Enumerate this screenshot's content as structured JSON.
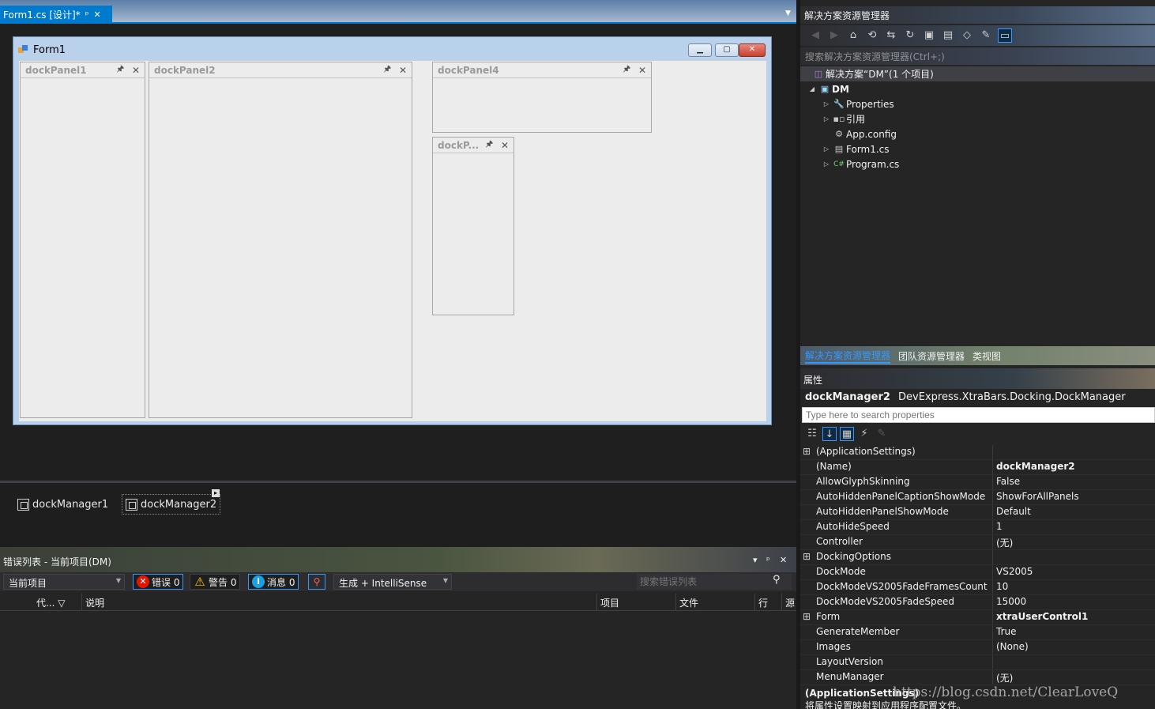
{
  "doc_tab": {
    "title": "Form1.cs [设计]*",
    "pin": "ᵖ",
    "close": "✕"
  },
  "form": {
    "title": "Form1",
    "panels": [
      {
        "caption": "dockPanel1"
      },
      {
        "caption": "dockPanel2"
      },
      {
        "caption": "dockPanel4"
      },
      {
        "caption": "dockP..."
      }
    ],
    "pin_glyph": "🖈",
    "close_glyph": "✕"
  },
  "tray": {
    "items": [
      "dockManager1",
      "dockManager2"
    ]
  },
  "error_list": {
    "title": "错误列表 - 当前项目(DM)",
    "scope": "当前项目",
    "errors_label": "错误 0",
    "warnings_label": "警告 0",
    "messages_label": "消息 0",
    "build_filter": "生成 + IntelliSense",
    "search_placeholder": "搜索错误列表",
    "columns": [
      "代...",
      "说明",
      "项目",
      "文件",
      "行",
      "源"
    ]
  },
  "solution_explorer": {
    "title": "解决方案资源管理器",
    "search_placeholder": "搜索解决方案资源管理器(Ctrl+;)",
    "tree": [
      {
        "label": "解决方案“DM”(1 个项目)",
        "icon": "solution-icon"
      },
      {
        "label": "DM",
        "icon": "csharp-project-icon"
      },
      {
        "label": "Properties",
        "icon": "wrench-icon"
      },
      {
        "label": "引用",
        "icon": "references-icon"
      },
      {
        "label": "App.config",
        "icon": "config-icon"
      },
      {
        "label": "Form1.cs",
        "icon": "form-icon"
      },
      {
        "label": "Program.cs",
        "icon": "csharp-file-icon"
      }
    ],
    "tabs": [
      "解决方案资源管理器",
      "团队资源管理器",
      "类视图"
    ]
  },
  "properties": {
    "title": "属性",
    "object_name": "dockManager2",
    "object_type": "DevExpress.XtraBars.Docking.DockManager",
    "search_placeholder": "Type here to search properties",
    "rows": [
      {
        "name": "(ApplicationSettings)",
        "value": "",
        "expand": "⊞"
      },
      {
        "name": "(Name)",
        "value": "dockManager2",
        "bold": true
      },
      {
        "name": "AllowGlyphSkinning",
        "value": "False"
      },
      {
        "name": "AutoHiddenPanelCaptionShowMode",
        "value": "ShowForAllPanels"
      },
      {
        "name": "AutoHiddenPanelShowMode",
        "value": "Default"
      },
      {
        "name": "AutoHideSpeed",
        "value": "1"
      },
      {
        "name": "Controller",
        "value": "(无)"
      },
      {
        "name": "DockingOptions",
        "value": "",
        "expand": "⊞"
      },
      {
        "name": "DockMode",
        "value": "VS2005"
      },
      {
        "name": "DockModeVS2005FadeFramesCount",
        "value": "10"
      },
      {
        "name": "DockModeVS2005FadeSpeed",
        "value": "15000"
      },
      {
        "name": "Form",
        "value": "xtraUserControl1",
        "bold": true,
        "expand": "⊞"
      },
      {
        "name": "GenerateMember",
        "value": "True"
      },
      {
        "name": "Images",
        "value": "(None)"
      },
      {
        "name": "LayoutVersion",
        "value": ""
      },
      {
        "name": "MenuManager",
        "value": "(无)"
      }
    ],
    "description_title": "(ApplicationSettings)",
    "description_text": "将属性设置映射到应用程序配置文件。"
  },
  "watermark": "https://blog.csdn.net/ClearLoveQ"
}
